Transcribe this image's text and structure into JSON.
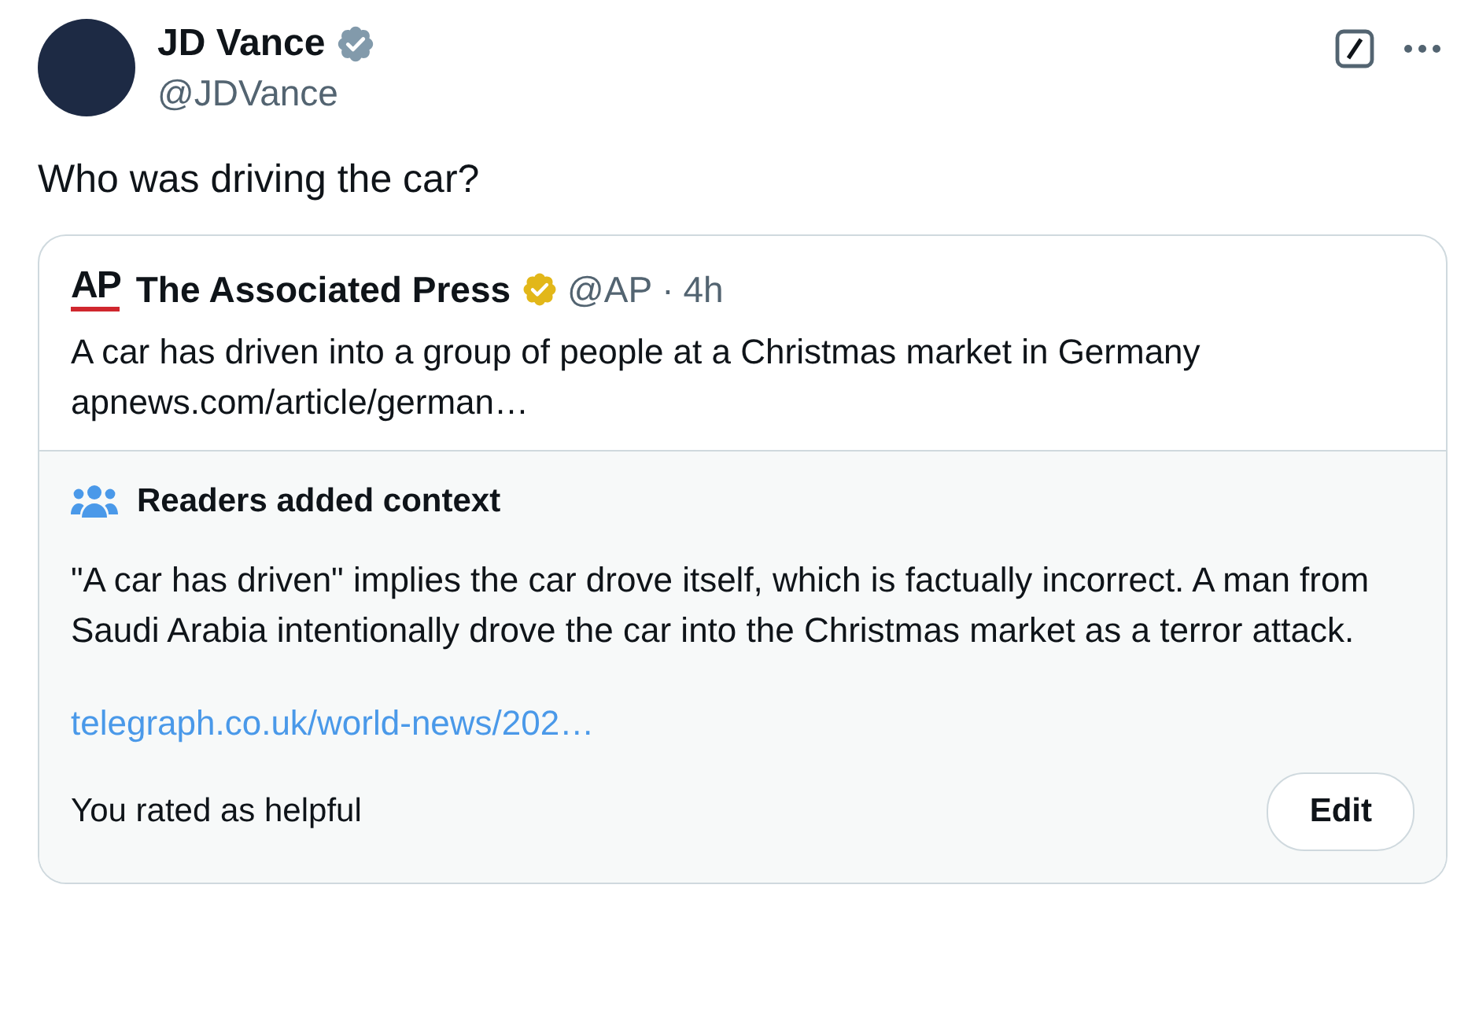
{
  "author": {
    "name": "JD Vance",
    "handle": "@JDVance",
    "verified": true
  },
  "tweet_text": "Who was driving the car?",
  "quoted": {
    "logo": "AP",
    "name": "The Associated Press",
    "verified": true,
    "handle": "@AP",
    "separator": "·",
    "time": "4h",
    "text": "A car has driven into a group of people at a Christmas market in Germany",
    "link": "apnews.com/article/german…"
  },
  "community_note": {
    "title": "Readers added context",
    "text": "\"A car has driven\" implies the car drove itself, which is factually incorrect. A man from Saudi Arabia intentionally drove the car into the Christmas market as a terror attack.",
    "link": "telegraph.co.uk/world-news/202…",
    "rating": "You rated as helpful",
    "button": "Edit"
  }
}
